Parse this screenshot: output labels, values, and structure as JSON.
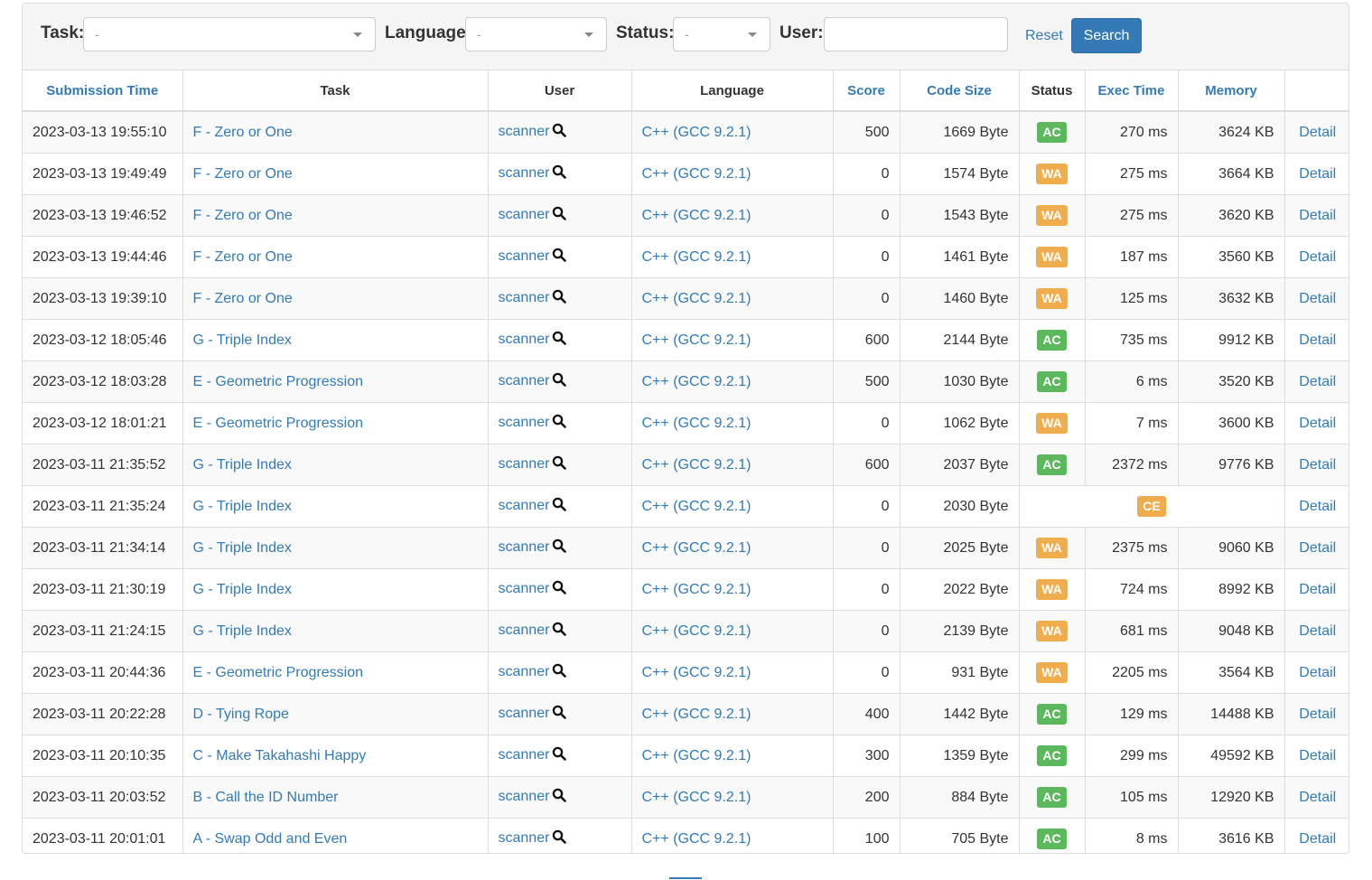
{
  "filters": {
    "task_label": "Task:",
    "task_value": "-",
    "language_label": "Language:",
    "language_value": "-",
    "status_label": "Status:",
    "status_value": "-",
    "user_label": "User:",
    "user_value": "",
    "reset_label": "Reset",
    "search_label": "Search"
  },
  "columns": [
    "Submission Time",
    "Task",
    "User",
    "Language",
    "Score",
    "Code Size",
    "Status",
    "Exec Time",
    "Memory",
    ""
  ],
  "sortable": [
    true,
    false,
    false,
    false,
    true,
    true,
    false,
    true,
    true,
    false
  ],
  "colors": {
    "link": "#337ab7",
    "AC": "#5cb85c",
    "WA": "#f0ad4e",
    "CE": "#f0ad4e"
  },
  "icons": {
    "user_search": "magnifier-icon"
  },
  "rows": [
    {
      "time": "2023-03-13 19:55:10",
      "task": "F - Zero or One",
      "user": "scanner",
      "lang": "C++ (GCC 9.2.1)",
      "score": "500",
      "size": "1669 Byte",
      "status": "AC",
      "exec": "270 ms",
      "mem": "3624 KB",
      "detail": "Detail"
    },
    {
      "time": "2023-03-13 19:49:49",
      "task": "F - Zero or One",
      "user": "scanner",
      "lang": "C++ (GCC 9.2.1)",
      "score": "0",
      "size": "1574 Byte",
      "status": "WA",
      "exec": "275 ms",
      "mem": "3664 KB",
      "detail": "Detail"
    },
    {
      "time": "2023-03-13 19:46:52",
      "task": "F - Zero or One",
      "user": "scanner",
      "lang": "C++ (GCC 9.2.1)",
      "score": "0",
      "size": "1543 Byte",
      "status": "WA",
      "exec": "275 ms",
      "mem": "3620 KB",
      "detail": "Detail"
    },
    {
      "time": "2023-03-13 19:44:46",
      "task": "F - Zero or One",
      "user": "scanner",
      "lang": "C++ (GCC 9.2.1)",
      "score": "0",
      "size": "1461 Byte",
      "status": "WA",
      "exec": "187 ms",
      "mem": "3560 KB",
      "detail": "Detail"
    },
    {
      "time": "2023-03-13 19:39:10",
      "task": "F - Zero or One",
      "user": "scanner",
      "lang": "C++ (GCC 9.2.1)",
      "score": "0",
      "size": "1460 Byte",
      "status": "WA",
      "exec": "125 ms",
      "mem": "3632 KB",
      "detail": "Detail"
    },
    {
      "time": "2023-03-12 18:05:46",
      "task": "G - Triple Index",
      "user": "scanner",
      "lang": "C++ (GCC 9.2.1)",
      "score": "600",
      "size": "2144 Byte",
      "status": "AC",
      "exec": "735 ms",
      "mem": "9912 KB",
      "detail": "Detail"
    },
    {
      "time": "2023-03-12 18:03:28",
      "task": "E - Geometric Progression",
      "user": "scanner",
      "lang": "C++ (GCC 9.2.1)",
      "score": "500",
      "size": "1030 Byte",
      "status": "AC",
      "exec": "6 ms",
      "mem": "3520 KB",
      "detail": "Detail"
    },
    {
      "time": "2023-03-12 18:01:21",
      "task": "E - Geometric Progression",
      "user": "scanner",
      "lang": "C++ (GCC 9.2.1)",
      "score": "0",
      "size": "1062 Byte",
      "status": "WA",
      "exec": "7 ms",
      "mem": "3600 KB",
      "detail": "Detail"
    },
    {
      "time": "2023-03-11 21:35:52",
      "task": "G - Triple Index",
      "user": "scanner",
      "lang": "C++ (GCC 9.2.1)",
      "score": "600",
      "size": "2037 Byte",
      "status": "AC",
      "exec": "2372 ms",
      "mem": "9776 KB",
      "detail": "Detail"
    },
    {
      "time": "2023-03-11 21:35:24",
      "task": "G - Triple Index",
      "user": "scanner",
      "lang": "C++ (GCC 9.2.1)",
      "score": "0",
      "size": "2030 Byte",
      "status": "CE",
      "exec": "",
      "mem": "",
      "detail": "Detail"
    },
    {
      "time": "2023-03-11 21:34:14",
      "task": "G - Triple Index",
      "user": "scanner",
      "lang": "C++ (GCC 9.2.1)",
      "score": "0",
      "size": "2025 Byte",
      "status": "WA",
      "exec": "2375 ms",
      "mem": "9060 KB",
      "detail": "Detail"
    },
    {
      "time": "2023-03-11 21:30:19",
      "task": "G - Triple Index",
      "user": "scanner",
      "lang": "C++ (GCC 9.2.1)",
      "score": "0",
      "size": "2022 Byte",
      "status": "WA",
      "exec": "724 ms",
      "mem": "8992 KB",
      "detail": "Detail"
    },
    {
      "time": "2023-03-11 21:24:15",
      "task": "G - Triple Index",
      "user": "scanner",
      "lang": "C++ (GCC 9.2.1)",
      "score": "0",
      "size": "2139 Byte",
      "status": "WA",
      "exec": "681 ms",
      "mem": "9048 KB",
      "detail": "Detail"
    },
    {
      "time": "2023-03-11 20:44:36",
      "task": "E - Geometric Progression",
      "user": "scanner",
      "lang": "C++ (GCC 9.2.1)",
      "score": "0",
      "size": "931 Byte",
      "status": "WA",
      "exec": "2205 ms",
      "mem": "3564 KB",
      "detail": "Detail"
    },
    {
      "time": "2023-03-11 20:22:28",
      "task": "D - Tying Rope",
      "user": "scanner",
      "lang": "C++ (GCC 9.2.1)",
      "score": "400",
      "size": "1442 Byte",
      "status": "AC",
      "exec": "129 ms",
      "mem": "14488 KB",
      "detail": "Detail"
    },
    {
      "time": "2023-03-11 20:10:35",
      "task": "C - Make Takahashi Happy",
      "user": "scanner",
      "lang": "C++ (GCC 9.2.1)",
      "score": "300",
      "size": "1359 Byte",
      "status": "AC",
      "exec": "299 ms",
      "mem": "49592 KB",
      "detail": "Detail"
    },
    {
      "time": "2023-03-11 20:03:52",
      "task": "B - Call the ID Number",
      "user": "scanner",
      "lang": "C++ (GCC 9.2.1)",
      "score": "200",
      "size": "884 Byte",
      "status": "AC",
      "exec": "105 ms",
      "mem": "12920 KB",
      "detail": "Detail"
    },
    {
      "time": "2023-03-11 20:01:01",
      "task": "A - Swap Odd and Even",
      "user": "scanner",
      "lang": "C++ (GCC 9.2.1)",
      "score": "100",
      "size": "705 Byte",
      "status": "AC",
      "exec": "8 ms",
      "mem": "3616 KB",
      "detail": "Detail"
    }
  ]
}
